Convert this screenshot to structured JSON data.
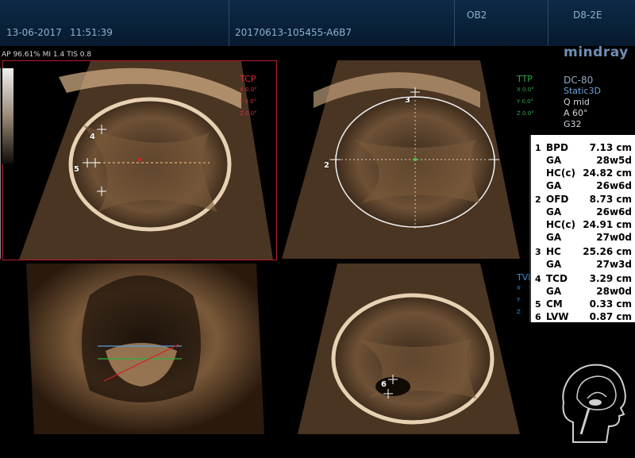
{
  "header": {
    "date": "13-06-2017",
    "time": "11:51:39",
    "exam_id": "20170613-105455-A6B7",
    "preset": "OB2",
    "probe": "D8-2E"
  },
  "status_line": "AP 96.61% MI 1.4 TIS 0.8",
  "brand": "mindray",
  "params": {
    "probe": "DC-80",
    "mode": "Static3D",
    "quality": "Q mid",
    "angle": "A 60°",
    "gain": "G32"
  },
  "planes": [
    {
      "name": "TCP",
      "color": "#d23040",
      "x": "X 0.0°",
      "y": "Y 0.0°",
      "z": "Z 0.0°"
    },
    {
      "name": "TTP",
      "color": "#2ea84a",
      "x": "X 0.0°",
      "y": "Y 0.0°",
      "z": "Z 0.0°"
    },
    {
      "name": "TVP",
      "color": "#3a8fd8",
      "x": "X",
      "y": "Y",
      "z": "Z"
    }
  ],
  "caliper_markers": [
    "2",
    "3",
    "4",
    "5",
    "6"
  ],
  "measurements": [
    {
      "idx": "1",
      "label": "BPD",
      "value": "7.13 cm"
    },
    {
      "idx": "",
      "label": "GA",
      "value": "28w5d"
    },
    {
      "idx": "",
      "label": "HC(c)",
      "value": "24.82 cm"
    },
    {
      "idx": "",
      "label": "GA",
      "value": "26w6d"
    },
    {
      "idx": "2",
      "label": "OFD",
      "value": "8.73 cm"
    },
    {
      "idx": "",
      "label": "GA",
      "value": "26w6d"
    },
    {
      "idx": "",
      "label": "HC(c)",
      "value": "24.91 cm"
    },
    {
      "idx": "",
      "label": "GA",
      "value": "27w0d"
    },
    {
      "idx": "3",
      "label": "HC",
      "value": "25.26 cm"
    },
    {
      "idx": "",
      "label": "GA",
      "value": "27w3d"
    },
    {
      "idx": "4",
      "label": "TCD",
      "value": "3.29 cm"
    },
    {
      "idx": "",
      "label": "GA",
      "value": "28w0d"
    },
    {
      "idx": "5",
      "label": "CM",
      "value": "0.33 cm"
    },
    {
      "idx": "6",
      "label": "LVW",
      "value": "0.87 cm"
    }
  ],
  "colors": {
    "header_bg": "#0d2a47",
    "active_border": "#b21f2e",
    "panel_bg": "#ffffff",
    "tissue": "#9c7a58"
  }
}
